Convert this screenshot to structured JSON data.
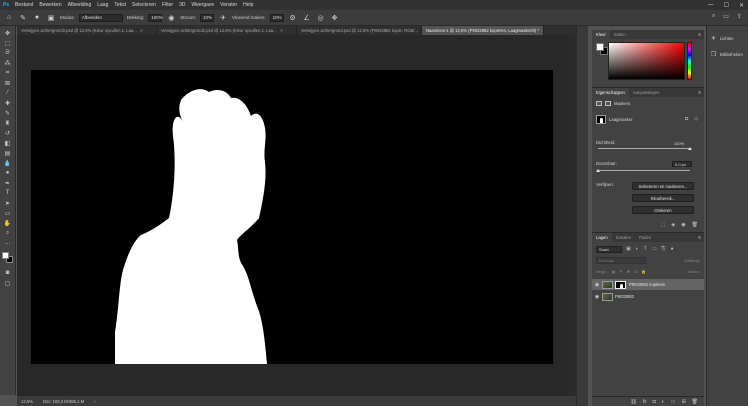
{
  "menubar": {
    "logo": "Ps",
    "items": [
      "Bestand",
      "Bewerken",
      "Afbeelding",
      "Laag",
      "Tekst",
      "Selecteren",
      "Filter",
      "3D",
      "Weergave",
      "Venster",
      "Help"
    ],
    "window_controls": [
      "—",
      "☐",
      "✕"
    ]
  },
  "options_bar": {
    "modus_label": "Modus:",
    "modus_value": "Afbeelden",
    "dekking_label": "Dekking:",
    "dekking_value": "100%",
    "stroom_label": "Stroom:",
    "stroom_value": "10%",
    "vloeiend_label": "Vloeiend maken:",
    "vloeiend_value": "10%"
  },
  "tabs": [
    {
      "label": "Verwijgen achtergrond3.psd @ 12,5% (Kleur opvullen 1, Laa..."
    },
    {
      "label": "Verwijgen achtergrond2.psd @ 12,5% (Kleur opvullen 1, Laa..."
    },
    {
      "label": "Verwijgen achtergrond.psd @ 12,5% (P9033882 kopie, RGB/..."
    },
    {
      "label": "Naamloos-1 @ 12,5% (P9033882 kopiëren, Laagmasker/8) *",
      "active": true
    }
  ],
  "status": {
    "zoom": "12,5%",
    "doc": "Doc: 183,3 M/395,1 M"
  },
  "color_panel": {
    "tabs": [
      "Kleur",
      "Stalen"
    ]
  },
  "properties_panel": {
    "tabs": [
      "Eigenschappen",
      "Aanpassingen"
    ],
    "masks_label": "Maskers",
    "layer_mask_label": "Laagmasker",
    "density_label": "Dichtheid:",
    "density_value": "100%",
    "density": 1.0,
    "feather_label": "Doezelaar:",
    "feather_value": "0,0 px",
    "feather": 0.0,
    "refine_label": "Verfijnen:",
    "btn_select_mask": "Selecteren en maskeren...",
    "btn_color_range": "Kleurbereik...",
    "btn_invert": "Omkeren"
  },
  "layers_panel": {
    "tabs": [
      "Lagen",
      "Kanalen",
      "Paden"
    ],
    "kind_filter": "Soort",
    "blend_mode": "Normaal",
    "opacity_label": "Dekking:",
    "fill_label": "Vullen:",
    "lock_label": "Vergr.:",
    "layers": [
      {
        "name": "P9033882 kopiëren",
        "selected": true,
        "has_mask": true
      },
      {
        "name": "P9033882",
        "selected": false,
        "has_mask": false
      }
    ]
  },
  "far_dock": {
    "items": [
      "Lichten",
      "Bibliotheken"
    ]
  }
}
